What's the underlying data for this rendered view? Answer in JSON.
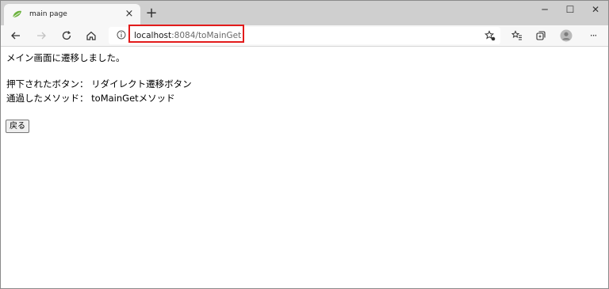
{
  "browser": {
    "tab": {
      "title": "main page",
      "close_label": "×",
      "favicon": "leaf-icon"
    },
    "new_tab_label": "+",
    "window_controls": {
      "minimize": "─",
      "maximize": "☐",
      "close": "✕"
    },
    "toolbar": {
      "back_icon": "arrow-left-icon",
      "forward_icon": "arrow-right-icon",
      "refresh_icon": "refresh-icon",
      "home_icon": "home-icon",
      "favorite_add_icon": "star-add-icon",
      "favorites_icon": "favorites-list-icon",
      "collections_icon": "collections-icon",
      "profile_icon": "profile-icon",
      "menu_label": "···"
    },
    "address_bar": {
      "host": "localhost",
      "rest": ":8084/toMainGet",
      "highlight_color": "#e21b1b"
    }
  },
  "page": {
    "heading": "メイン画面に遷移しました。",
    "pressed_button_line": "押下されたボタン： リダイレクト遷移ボタン",
    "method_line": "通過したメソッド： toMainGetメソッド",
    "back_button_label": "戻る"
  }
}
